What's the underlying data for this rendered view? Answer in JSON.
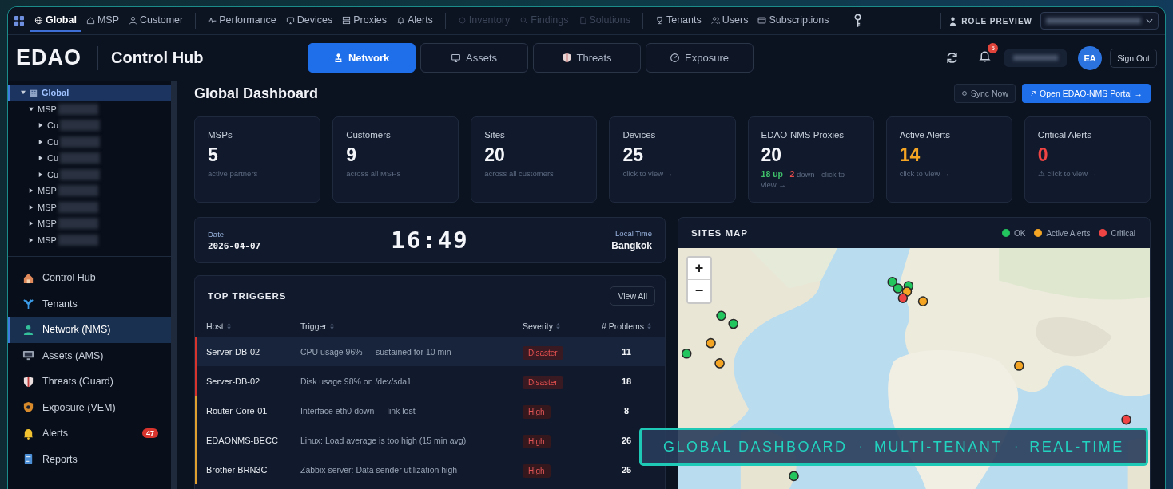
{
  "top_nav": {
    "groups": [
      [
        {
          "label": "Global",
          "selected": true,
          "disabled": false
        },
        {
          "label": "MSP",
          "selected": false,
          "disabled": false
        },
        {
          "label": "Customer",
          "selected": false,
          "disabled": false
        }
      ],
      [
        {
          "label": "Performance",
          "selected": false,
          "disabled": false
        },
        {
          "label": "Devices",
          "selected": false,
          "disabled": false
        },
        {
          "label": "Proxies",
          "selected": false,
          "disabled": false
        },
        {
          "label": "Alerts",
          "selected": false,
          "disabled": false
        }
      ],
      [
        {
          "label": "Inventory",
          "selected": false,
          "disabled": true
        },
        {
          "label": "Findings",
          "selected": false,
          "disabled": true
        },
        {
          "label": "Solutions",
          "selected": false,
          "disabled": true
        }
      ],
      [
        {
          "label": "Tenants",
          "selected": false,
          "disabled": false
        },
        {
          "label": "Users",
          "selected": false,
          "disabled": false
        },
        {
          "label": "Subscriptions",
          "selected": false,
          "disabled": false
        }
      ]
    ],
    "role_preview": "ROLE PREVIEW"
  },
  "header": {
    "logo": "EDAO",
    "title": "Control Hub",
    "tabs": [
      {
        "label": "Network",
        "selected": true
      },
      {
        "label": "Assets",
        "selected": false
      },
      {
        "label": "Threats",
        "selected": false
      },
      {
        "label": "Exposure",
        "selected": false
      }
    ],
    "notifications": "5",
    "avatar": "EA",
    "sign_out": "Sign Out"
  },
  "sidebar": {
    "tree": [
      {
        "label": "Global",
        "expanded": true,
        "selected": true,
        "children": [
          {
            "label": "MSP",
            "expanded": true,
            "selected": false,
            "children": [
              {
                "label": "Cu",
                "expanded": false,
                "selected": false
              },
              {
                "label": "Cu",
                "expanded": false,
                "selected": false
              },
              {
                "label": "Cu",
                "expanded": false,
                "selected": false
              },
              {
                "label": "Cu",
                "expanded": false,
                "selected": false
              }
            ]
          },
          {
            "label": "MSP",
            "expanded": false,
            "selected": false
          },
          {
            "label": "MSP",
            "expanded": false,
            "selected": false
          },
          {
            "label": "MSP",
            "expanded": false,
            "selected": false
          },
          {
            "label": "MSP",
            "expanded": false,
            "selected": false
          }
        ]
      }
    ],
    "nav": [
      {
        "label": "Control Hub",
        "selected": false
      },
      {
        "label": "Tenants",
        "selected": false
      },
      {
        "label": "Network (NMS)",
        "selected": true
      },
      {
        "label": "Assets (AMS)",
        "selected": false
      },
      {
        "label": "Threats (Guard)",
        "selected": false
      },
      {
        "label": "Exposure (VEM)",
        "selected": false
      },
      {
        "label": "Alerts",
        "selected": false,
        "badge": "47"
      },
      {
        "label": "Reports",
        "selected": false
      }
    ]
  },
  "dashboard": {
    "title": "Global Dashboard",
    "sync": "Sync Now",
    "open_portal": "Open EDAO-NMS Portal →",
    "stats": [
      {
        "label": "MSPs",
        "value": "5",
        "color": "#f4f6fa",
        "sub": [
          {
            "text": "active partners"
          }
        ]
      },
      {
        "label": "Customers",
        "value": "9",
        "color": "#f4f6fa",
        "sub": [
          {
            "text": "across all MSPs"
          }
        ]
      },
      {
        "label": "Sites",
        "value": "20",
        "color": "#f4f6fa",
        "sub": [
          {
            "text": "across all customers"
          }
        ]
      },
      {
        "label": "Devices",
        "value": "25",
        "color": "#f4f6fa",
        "sub": [
          {
            "text": "click to view →"
          }
        ]
      },
      {
        "label": "EDAO-NMS Proxies",
        "value": "20",
        "color": "#f4f6fa",
        "sub": [
          {
            "text": "18 up",
            "color": "#3fbf6a"
          },
          {
            "text": "·"
          },
          {
            "text": "2",
            "color": "#e04a4a"
          },
          {
            "text": "down · click to view →"
          }
        ]
      },
      {
        "label": "Active Alerts",
        "value": "14",
        "color": "#f5a524",
        "sub": [
          {
            "text": "click to view →"
          }
        ]
      },
      {
        "label": "Critical Alerts",
        "value": "0",
        "color": "#ef4444",
        "sub": [
          {
            "text": "⚠ click to view →"
          }
        ]
      }
    ],
    "clock": {
      "date_label": "Date",
      "date": "2026-04-07",
      "time": "16:49",
      "zone_label": "Local Time",
      "zone": "Bangkok"
    },
    "triggers": {
      "title": "TOP TRIGGERS",
      "view_all": "View All",
      "columns": [
        "Host",
        "Trigger",
        "Severity",
        "# Problems"
      ],
      "rows": [
        {
          "host": "Server-DB-02",
          "trigger": "CPU usage 96% — sustained for 10 min",
          "severity": "Disaster",
          "kind": "disaster",
          "problems": "11",
          "selected": true
        },
        {
          "host": "Server-DB-02",
          "trigger": "Disk usage 98% on /dev/sda1",
          "severity": "Disaster",
          "kind": "disaster",
          "problems": "18",
          "selected": false
        },
        {
          "host": "Router-Core-01",
          "trigger": "Interface eth0 down — link lost",
          "severity": "High",
          "kind": "high",
          "problems": "8",
          "selected": false
        },
        {
          "host": "EDAONMS-BECC",
          "trigger": "Linux: Load average is too high (15 min avg)",
          "severity": "High",
          "kind": "high",
          "problems": "26",
          "selected": false
        },
        {
          "host": "Brother BRN3C",
          "trigger": "Zabbix server: Data sender utilization high",
          "severity": "High",
          "kind": "high",
          "problems": "25",
          "selected": false
        }
      ]
    },
    "map": {
      "title": "SITES MAP",
      "legend": [
        {
          "label": "OK",
          "color": "#22c55e"
        },
        {
          "label": "Active Alerts",
          "color": "#f5a524"
        },
        {
          "label": "Critical",
          "color": "#ef4444"
        }
      ],
      "zoom_in": "+",
      "zoom_out": "−",
      "kind": "picture"
    }
  },
  "caption": [
    {
      "text": "GLOBAL DASHBOARD",
      "kind": "label"
    },
    {
      "text": "·",
      "kind": "dot"
    },
    {
      "text": "MULTI-TENANT",
      "kind": "label"
    },
    {
      "text": "·",
      "kind": "dot"
    },
    {
      "text": "REAL-TIME",
      "kind": "label"
    }
  ]
}
